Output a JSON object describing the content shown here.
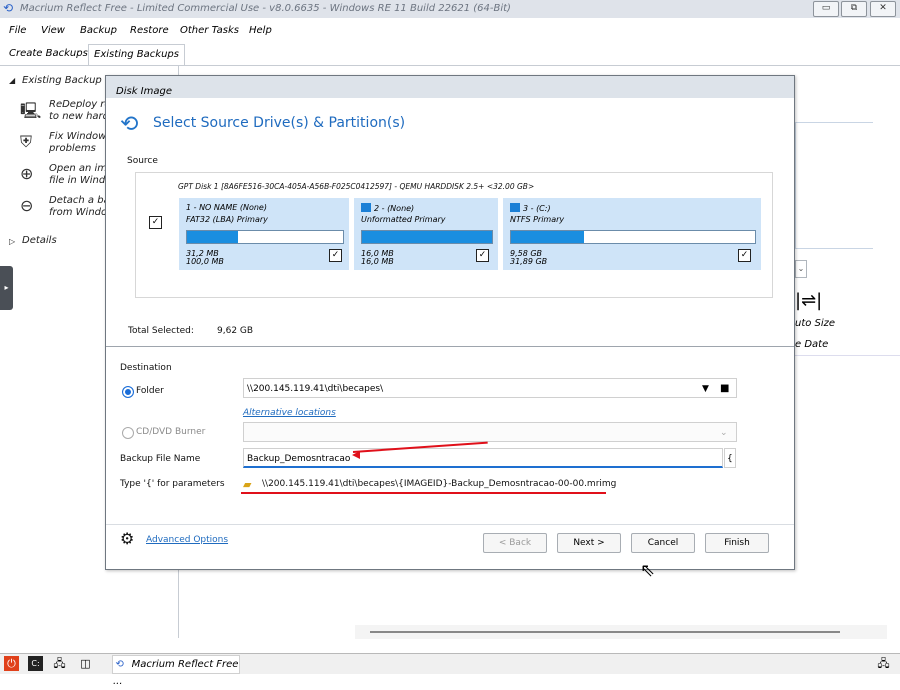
{
  "window": {
    "title": "Macrium Reflect Free - Limited Commercial Use - v8.0.6635 - Windows RE 11 Build 22621 (64-Bit)",
    "minimize": "▭",
    "restore": "⧉",
    "close": "✕"
  },
  "menu": [
    "File",
    "View",
    "Backup",
    "Restore",
    "Other Tasks",
    "Help"
  ],
  "tabs": [
    "Create Backups",
    "Existing Backups"
  ],
  "left_panel": {
    "group": "Existing Backup To",
    "items": [
      {
        "line1": "ReDeploy re",
        "line2": "to new hard"
      },
      {
        "line1": "Fix Windows",
        "line2": "problems"
      },
      {
        "line1": "Open an im",
        "line2": "file in Windo"
      },
      {
        "line1": "Detach a ba",
        "line2": "from Windo"
      }
    ],
    "details": "Details"
  },
  "right_panel": {
    "auto_size": "uto Size",
    "date": "e  Date"
  },
  "dialog": {
    "title": "Disk Image",
    "heading": "Select Source Drive(s) & Partition(s)",
    "source_label": "Source",
    "disk_label": "GPT Disk 1 [8A6FE516-30CA-405A-A56B-F025C0412597] - QEMU HARDDISK 2.5+  <32.00 GB>",
    "partitions": [
      {
        "name": "1 - NO NAME (None)",
        "type": "FAT32 (LBA) Primary",
        "used": "31,2 MB",
        "total": "100,0 MB",
        "fill": 0.33
      },
      {
        "name": "2 -  (None)",
        "type": "Unformatted Primary",
        "used": "16,0 MB",
        "total": "16,0 MB",
        "fill": 1.0
      },
      {
        "name": "3 -  (C:)",
        "type": "NTFS Primary",
        "used": "9,58 GB",
        "total": "31,89 GB",
        "fill": 0.3
      }
    ],
    "total_selected_label": "Total Selected:",
    "total_selected_value": "9,62 GB",
    "destination_label": "Destination",
    "folder_label": "Folder",
    "folder_value": "\\\\200.145.119.41\\dti\\becapes\\",
    "alt_locations": "Alternative locations",
    "cd_label": "CD/DVD Burner",
    "file_name_label": "Backup File Name",
    "file_name_value": "Backup_Demosntracao",
    "brace_button": "{",
    "params_label": "Type '{' for parameters",
    "path_preview": "\\\\200.145.119.41\\dti\\becapes\\{IMAGEID}-Backup_Demosntracao-00-00.mrimg",
    "advanced": "Advanced Options",
    "buttons": {
      "back": "< Back",
      "next": "Next >",
      "cancel": "Cancel",
      "finish": "Finish"
    }
  },
  "taskbar": {
    "app": "Macrium Reflect Free ..."
  },
  "colors": {
    "accent": "#1f6bbf",
    "partition_bg": "#cfe4f8",
    "bar_fill": "#1a8ee0",
    "annotation": "#e0101a"
  }
}
